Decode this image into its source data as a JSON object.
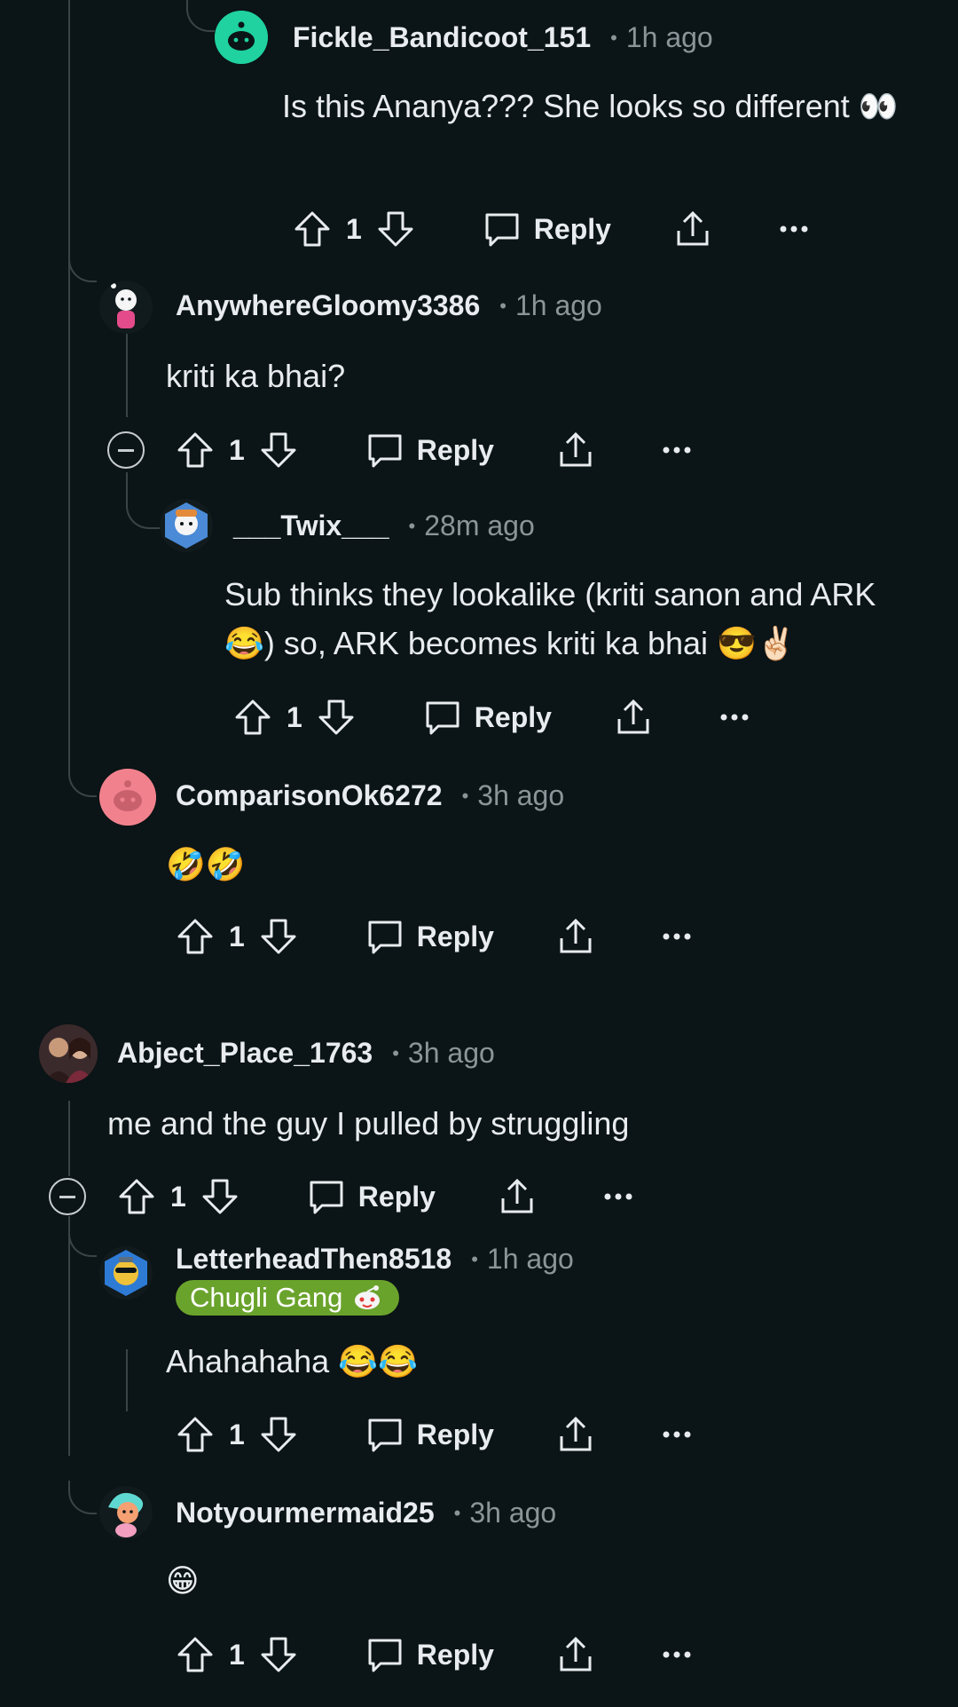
{
  "comments": [
    {
      "author": "Fickle_Bandicoot_151",
      "time": "1h ago",
      "text": "Is this Ananya??? She looks so different 👀",
      "score": "1",
      "reply": "Reply",
      "avatar_color": "#1fd2a0"
    },
    {
      "author": "AnywhereGloomy3386",
      "time": "1h ago",
      "text": "kriti ka bhai?",
      "score": "1",
      "reply": "Reply",
      "avatar_color": "#e44b8a"
    },
    {
      "author": "___Twix___",
      "time": "28m ago",
      "text": "Sub thinks they lookalike (kriti sanon and ARK 😂) so, ARK becomes kriti ka bhai 😎✌🏻",
      "score": "1",
      "reply": "Reply",
      "avatar_color": "#4a8ad6"
    },
    {
      "author": "ComparisonOk6272",
      "time": "3h ago",
      "text": "🤣🤣",
      "score": "1",
      "reply": "Reply",
      "avatar_color": "#f1828d"
    },
    {
      "author": "Abject_Place_1763",
      "time": "3h ago",
      "text": "me and the guy I pulled by struggling",
      "score": "1",
      "reply": "Reply",
      "avatar_color": "#6a3a3a"
    },
    {
      "author": "LetterheadThen8518",
      "time": "1h ago",
      "flair": "Chugli Gang",
      "text": "Ahahahaha 😂😂",
      "score": "1",
      "reply": "Reply",
      "avatar_color": "#2e7bd6"
    },
    {
      "author": "Notyourmermaid25",
      "time": "3h ago",
      "text": "😁",
      "score": "1",
      "reply": "Reply",
      "avatar_color": "#5fd8d2"
    }
  ],
  "icons": {
    "upvote": "upvote-icon",
    "downvote": "downvote-icon",
    "reply": "reply-icon",
    "share": "share-icon",
    "more": "more-icon",
    "collapse": "collapse-icon"
  },
  "colors": {
    "background": "#0b1416",
    "flair": "#6aa32c",
    "thread_line": "#3a4447",
    "muted_text": "#8b9599"
  }
}
